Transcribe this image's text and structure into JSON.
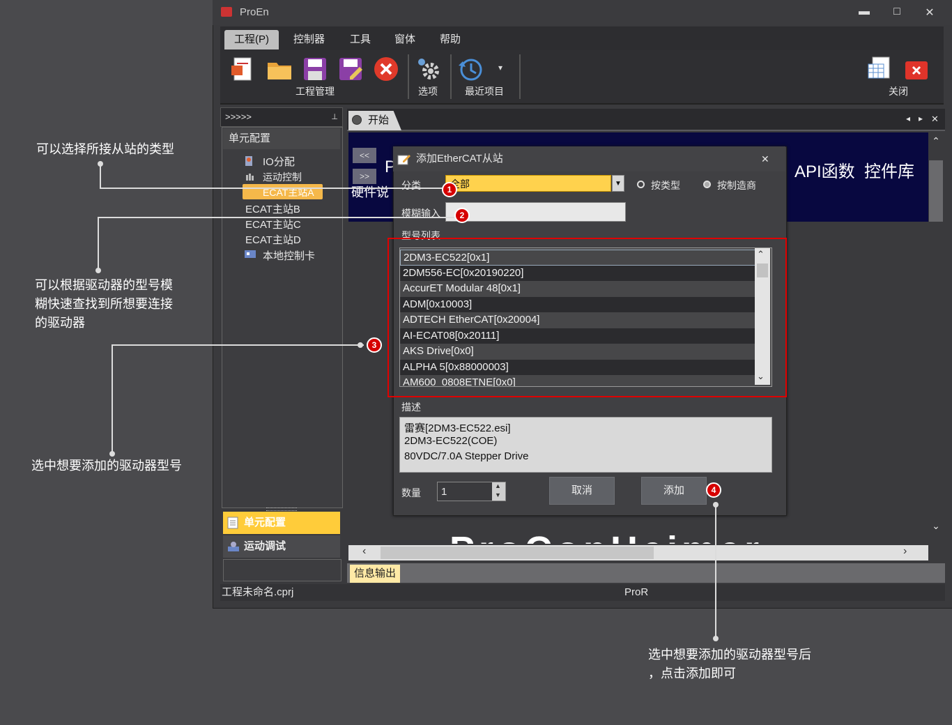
{
  "app": {
    "title": "ProEn"
  },
  "window_controls": {
    "minimize": "▬",
    "maximize": "□",
    "close": "✕"
  },
  "menu": [
    {
      "label": "工程(P)"
    },
    {
      "label": "控制器"
    },
    {
      "label": "工具"
    },
    {
      "label": "窗体"
    },
    {
      "label": "帮助"
    }
  ],
  "toolbar": {
    "group_project": "工程管理",
    "options": "选项",
    "recent": "最近项目",
    "close": "关闭",
    "dropdown": "▾"
  },
  "left_panel": {
    "header": ">>>>>",
    "pin": "⊥",
    "section": "单元配置",
    "tree": {
      "io": "IO分配",
      "motion": "运动控制",
      "ecat_a": "ECAT主站A",
      "ecat_b": "ECAT主站B",
      "ecat_c": "ECAT主站C",
      "ecat_d": "ECAT主站D",
      "local_card": "本地控制卡"
    },
    "tab_unit": "单元配置",
    "tab_motion": "运动调试"
  },
  "doc_tab": {
    "label": "开始",
    "nav_left": "◂",
    "nav_right": "▸",
    "close": "✕"
  },
  "start_page": {
    "banner_left": "P",
    "banner_sub": "硬件说",
    "api": "API函数",
    "widgets": "控件库",
    "nav_prev": "<<",
    "nav_next": ">>",
    "logo": "ProConHeimer"
  },
  "info_tab": "信息输出",
  "status": {
    "file": "工程未命名.cprj",
    "center": "ProR"
  },
  "dialog": {
    "title": "添加EtherCAT从站",
    "close": "✕",
    "category_label": "分类",
    "category_value": "全部",
    "radio_by_type": "按类型",
    "radio_by_vendor": "按制造商",
    "fuzzy_label": "模糊输入",
    "fuzzy_value": "",
    "model_list_label": "型号列表",
    "models": [
      "2DM3-EC522[0x1]",
      "2DM556-EC[0x20190220]",
      "AccurET Modular 48[0x1]",
      "ADM[0x10003]",
      "ADTECH EtherCAT[0x20004]",
      "AI-ECAT08[0x20111]",
      "AKS Drive[0x0]",
      "ALPHA 5[0x88000003]",
      "AM600_0808ETNE[0x0]"
    ],
    "desc_label": "描述",
    "desc_lines": [
      "雷赛[2DM3-EC522.esi]",
      "2DM3-EC522(COE)",
      "80VDC/7.0A Stepper Drive"
    ],
    "qty_label": "数量",
    "qty_value": "1",
    "cancel": "取消",
    "add": "添加"
  },
  "annotations": {
    "a1": "可以选择所接从站的类型",
    "a2_l1": "可以根据驱动器的型号模",
    "a2_l2": "糊快速查找到所想要连接",
    "a2_l3": "的驱动器",
    "a3": "选中想要添加的驱动器型号",
    "a4_l1": "选中想要添加的驱动器型号后",
    "a4_l2": "，点击添加即可"
  },
  "badges": [
    "1",
    "2",
    "3",
    "4"
  ],
  "colors": {
    "highlight": "#ffd24d",
    "annotation_box": "#e00000",
    "badge": "#d60000",
    "banner": "#080840"
  }
}
